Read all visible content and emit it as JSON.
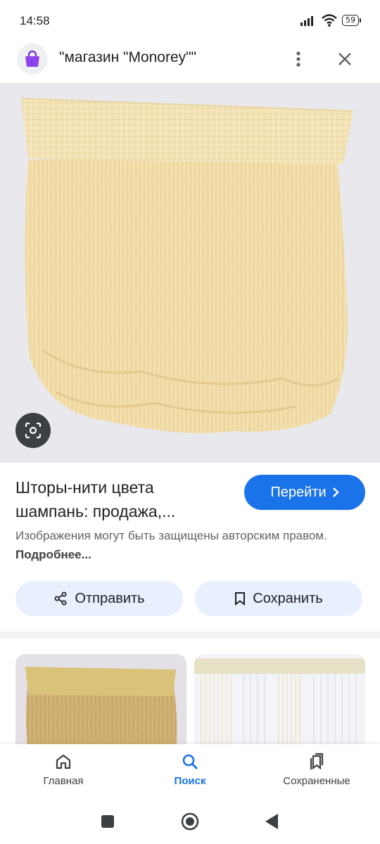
{
  "status_bar": {
    "time": "14:58",
    "battery": "59"
  },
  "header": {
    "title": "\"магазин \"Monorey\"\""
  },
  "result": {
    "title": "Шторы-нити цвета шампань: продажа,...",
    "goto_label": "Перейти",
    "copyright_text": "Изображения могут быть защищены авторским правом.",
    "copyright_link": "Подробнее..."
  },
  "actions": {
    "share_label": "Отправить",
    "save_label": "Сохранить"
  },
  "bottom_nav": {
    "items": [
      {
        "label": "Главная",
        "icon": "home-icon"
      },
      {
        "label": "Поиск",
        "icon": "search-icon",
        "active": true
      },
      {
        "label": "Сохраненные",
        "icon": "bookmarks-icon"
      }
    ]
  },
  "colors": {
    "accent": "#1a73e8",
    "chip_bg": "#e8f0fe",
    "curtain": "#f3dfae"
  }
}
